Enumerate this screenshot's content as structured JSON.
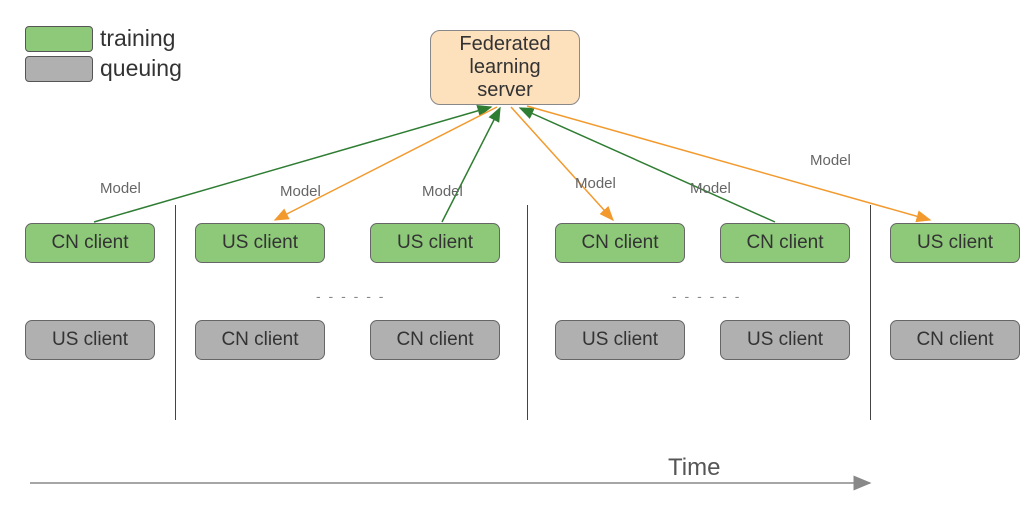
{
  "legend": {
    "training": "training",
    "queuing": "queuing"
  },
  "server": {
    "label": "Federated\nlearning\nserver"
  },
  "columns": [
    {
      "top_client": "CN client",
      "bottom_client": "US client",
      "arrow_dir": "up",
      "label": "Model"
    },
    {
      "top_client": "US client",
      "bottom_client": "CN client",
      "arrow_dir": "down",
      "label": "Model"
    },
    {
      "top_client": "US client",
      "bottom_client": "CN client",
      "arrow_dir": "up",
      "label": "Model"
    },
    {
      "top_client": "CN client",
      "bottom_client": "US client",
      "arrow_dir": "down",
      "label": "Model"
    },
    {
      "top_client": "CN client",
      "bottom_client": "US client",
      "arrow_dir": "up",
      "label": "Model"
    },
    {
      "top_client": "US client",
      "bottom_client": "CN client",
      "arrow_dir": "down",
      "label": "Model"
    }
  ],
  "time_label": "Time",
  "colors": {
    "training": "#8ec97a",
    "queuing": "#b0b0b0",
    "server_bg": "#fde0bc",
    "arrow_up": "#2e7d32",
    "arrow_down": "#f29a2e"
  }
}
